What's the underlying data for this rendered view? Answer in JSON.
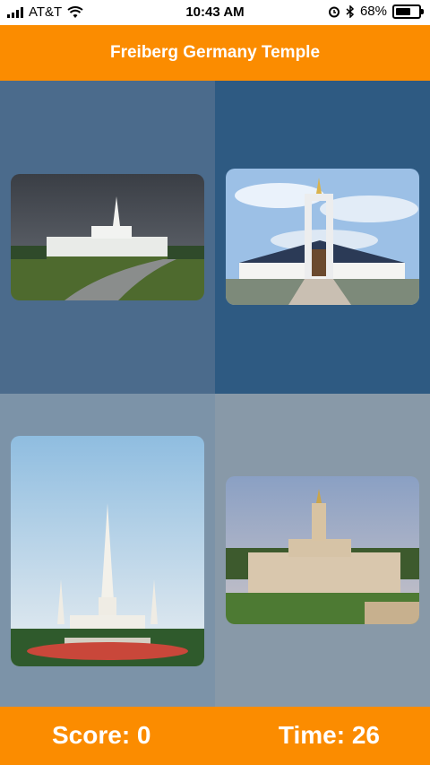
{
  "status_bar": {
    "carrier": "AT&T",
    "time": "10:43 AM",
    "battery": "68%"
  },
  "header": {
    "title": "Freiberg Germany Temple"
  },
  "cards": [
    {
      "name": "temple-photo-1"
    },
    {
      "name": "temple-photo-2"
    },
    {
      "name": "temple-photo-3"
    },
    {
      "name": "temple-photo-4"
    }
  ],
  "footer": {
    "score_label": "Score: 0",
    "time_label": "Time: 26"
  },
  "colors": {
    "accent": "#fb8c00",
    "tile_1": "#4b6b8c",
    "tile_2": "#2e5a82",
    "tile_3": "#7c93a8",
    "tile_4": "#8899a8"
  }
}
